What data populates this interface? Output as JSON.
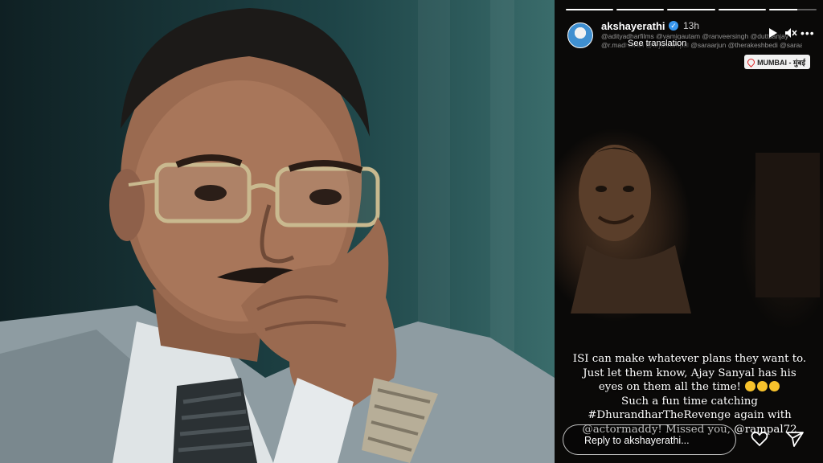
{
  "story": {
    "username": "akshayerathi",
    "time": "13h",
    "tags_line1": "@adityadharfilms @yamigautam @ranveersingh @duttsanjay",
    "tags_line2": "@r.madhavan @arjunrampal @saraarjun @therakeshbedi @saraarjunn",
    "translate_label": "See translation",
    "location": "MUMBAI - मुंबई",
    "progress": [
      1.0,
      1.0,
      1.0,
      1.0,
      0.6
    ],
    "caption_lines": [
      "ISI can make whatever plans they want to.",
      "Just let them know, Ajay Sanyal has his",
      "eyes on them all the time!",
      "Such a fun time catching",
      "#DhurandharTheRevenge again with",
      "@actormaddy! Missed you, @rampal72"
    ],
    "reply_placeholder": "Reply to akshayerathi..."
  },
  "icons": {
    "verified": "verified-badge-icon",
    "play": "play-icon",
    "mute": "mute-icon",
    "more": "more-icon",
    "pin": "location-pin-icon",
    "heart": "heart-icon",
    "share": "send-icon"
  },
  "colors": {
    "photo_bg": "#1e4447",
    "story_bg": "#0a0908",
    "verified": "#3897f0"
  }
}
